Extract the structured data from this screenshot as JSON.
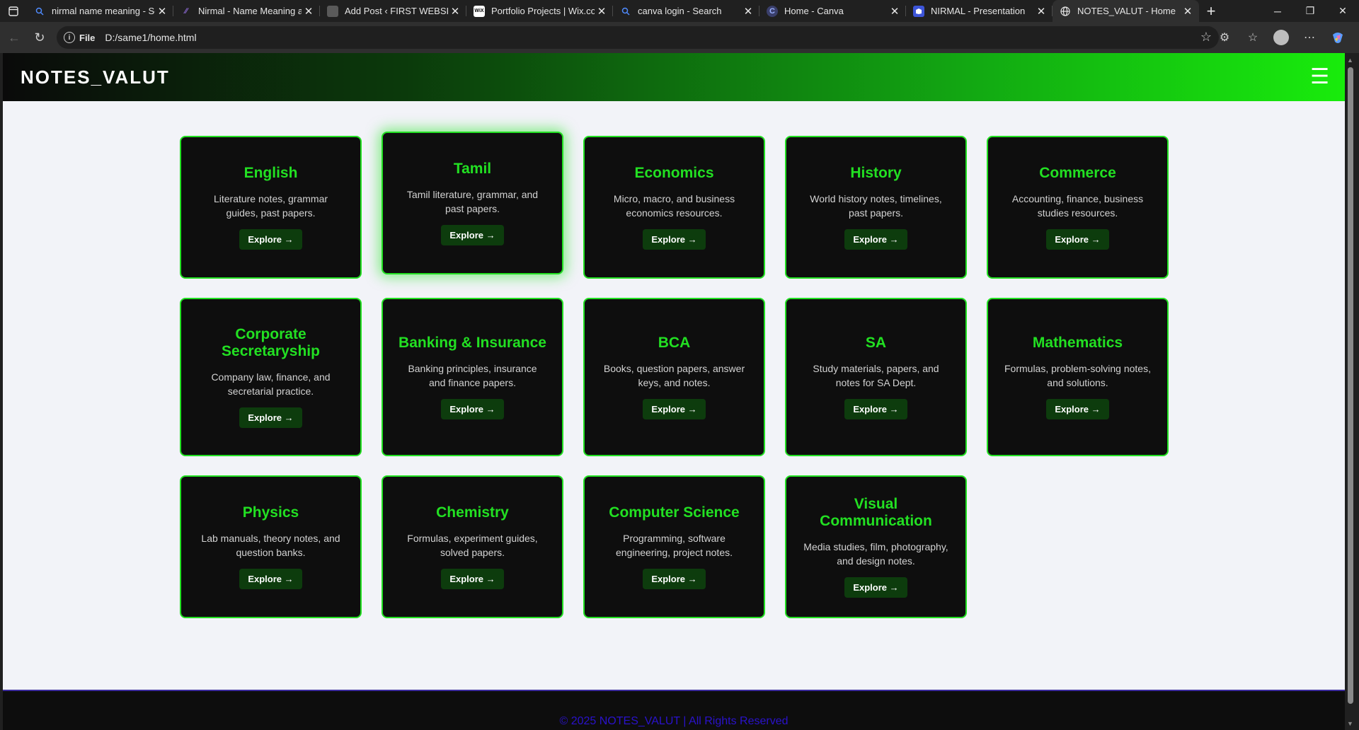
{
  "browser": {
    "tabs": [
      {
        "title": "nirmal name meaning - Sea",
        "icon": "search-icon",
        "active": false
      },
      {
        "title": "Nirmal - Name Meaning an",
        "icon": "site-icon",
        "active": false
      },
      {
        "title": "Add Post ‹ FIRST WEBSITE -",
        "icon": "wordpress-icon",
        "active": false
      },
      {
        "title": "Portfolio Projects | Wix.com",
        "icon": "wix-icon",
        "favicon_text": "WiX",
        "active": false
      },
      {
        "title": "canva login - Search",
        "icon": "search-icon",
        "active": false
      },
      {
        "title": "Home - Canva",
        "icon": "canva-icon",
        "favicon_text": "C",
        "active": false
      },
      {
        "title": "NIRMAL - Presentation",
        "icon": "presentation-icon",
        "active": false
      },
      {
        "title": "NOTES_VALUT - Home",
        "icon": "globe-icon",
        "active": true
      }
    ],
    "address": {
      "scheme_label": "File",
      "url": "D:/same1/home.html"
    }
  },
  "site": {
    "logo": "NOTES_VALUT",
    "menu_icon": "hamburger-icon",
    "accent_color": "#22e022",
    "cards": [
      {
        "title": "English",
        "desc": "Literature notes, grammar guides, past papers.",
        "cta": "Explore →"
      },
      {
        "title": "Tamil",
        "desc": "Tamil literature, grammar, and past papers.",
        "cta": "Explore →"
      },
      {
        "title": "Economics",
        "desc": "Micro, macro, and business economics resources.",
        "cta": "Explore →"
      },
      {
        "title": "History",
        "desc": "World history notes, timelines, past papers.",
        "cta": "Explore →"
      },
      {
        "title": "Commerce",
        "desc": "Accounting, finance, business studies resources.",
        "cta": "Explore →"
      },
      {
        "title": "Corporate Secretaryship",
        "desc": "Company law, finance, and secretarial practice.",
        "cta": "Explore →"
      },
      {
        "title": "Banking & Insurance",
        "desc": "Banking principles, insurance and finance papers.",
        "cta": "Explore →"
      },
      {
        "title": "BCA",
        "desc": "Books, question papers, answer keys, and notes.",
        "cta": "Explore →"
      },
      {
        "title": "SA",
        "desc": "Study materials, papers, and notes for SA Dept.",
        "cta": "Explore →"
      },
      {
        "title": "Mathematics",
        "desc": "Formulas, problem-solving notes, and solutions.",
        "cta": "Explore →"
      },
      {
        "title": "Physics",
        "desc": "Lab manuals, theory notes, and question banks.",
        "cta": "Explore →"
      },
      {
        "title": "Chemistry",
        "desc": "Formulas, experiment guides, solved papers.",
        "cta": "Explore →"
      },
      {
        "title": "Computer Science",
        "desc": "Programming, software engineering, project notes.",
        "cta": "Explore →"
      },
      {
        "title": "Visual Communication",
        "desc": "Media studies, film, photography, and design notes.",
        "cta": "Explore →"
      }
    ],
    "footer": "© 2025 NOTES_VALUT | All Rights Reserved"
  }
}
